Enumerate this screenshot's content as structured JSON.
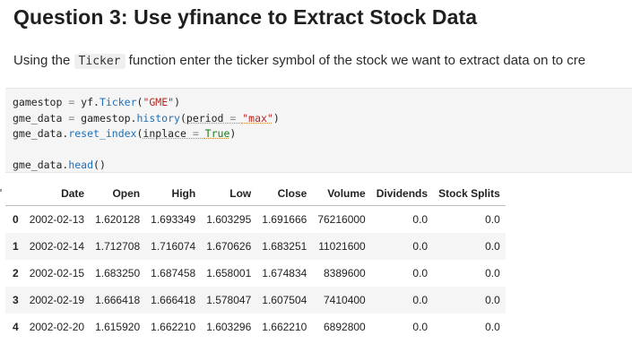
{
  "heading": "Question 3: Use yfinance to Extract Stock Data",
  "description": {
    "before": "Using the ",
    "code": "Ticker",
    "after": " function enter the ticker symbol of the stock we want to extract data on to cre"
  },
  "code_cell": {
    "line1": {
      "var": "gamestop",
      "op": " = ",
      "obj": "yf.",
      "fn": "Ticker",
      "open": "(",
      "str": "\"GME\"",
      "close": ")"
    },
    "line2": {
      "var": "gme_data",
      "op": " = ",
      "obj": "gamestop.",
      "fn": "history",
      "open": "(",
      "arg": "period",
      "eq": " = ",
      "str": "\"max\"",
      "close": ")"
    },
    "line3": {
      "obj": "gme_data.",
      "fn": "reset_index",
      "open": "(",
      "arg": "inplace",
      "eq": " = ",
      "kw": "True",
      "close": ")"
    },
    "line5": {
      "obj": "gme_data.",
      "fn": "head",
      "call": "()"
    }
  },
  "table": {
    "columns": [
      "",
      "Date",
      "Open",
      "High",
      "Low",
      "Close",
      "Volume",
      "Dividends",
      "Stock Splits"
    ],
    "rows": [
      [
        "0",
        "2002-02-13",
        "1.620128",
        "1.693349",
        "1.603295",
        "1.691666",
        "76216000",
        "0.0",
        "0.0"
      ],
      [
        "1",
        "2002-02-14",
        "1.712708",
        "1.716074",
        "1.670626",
        "1.683251",
        "11021600",
        "0.0",
        "0.0"
      ],
      [
        "2",
        "2002-02-15",
        "1.683250",
        "1.687458",
        "1.658001",
        "1.674834",
        "8389600",
        "0.0",
        "0.0"
      ],
      [
        "3",
        "2002-02-19",
        "1.666418",
        "1.666418",
        "1.578047",
        "1.607504",
        "7410400",
        "0.0",
        "0.0"
      ],
      [
        "4",
        "2002-02-20",
        "1.615920",
        "1.662210",
        "1.603296",
        "1.662210",
        "6892800",
        "0.0",
        "0.0"
      ]
    ]
  }
}
